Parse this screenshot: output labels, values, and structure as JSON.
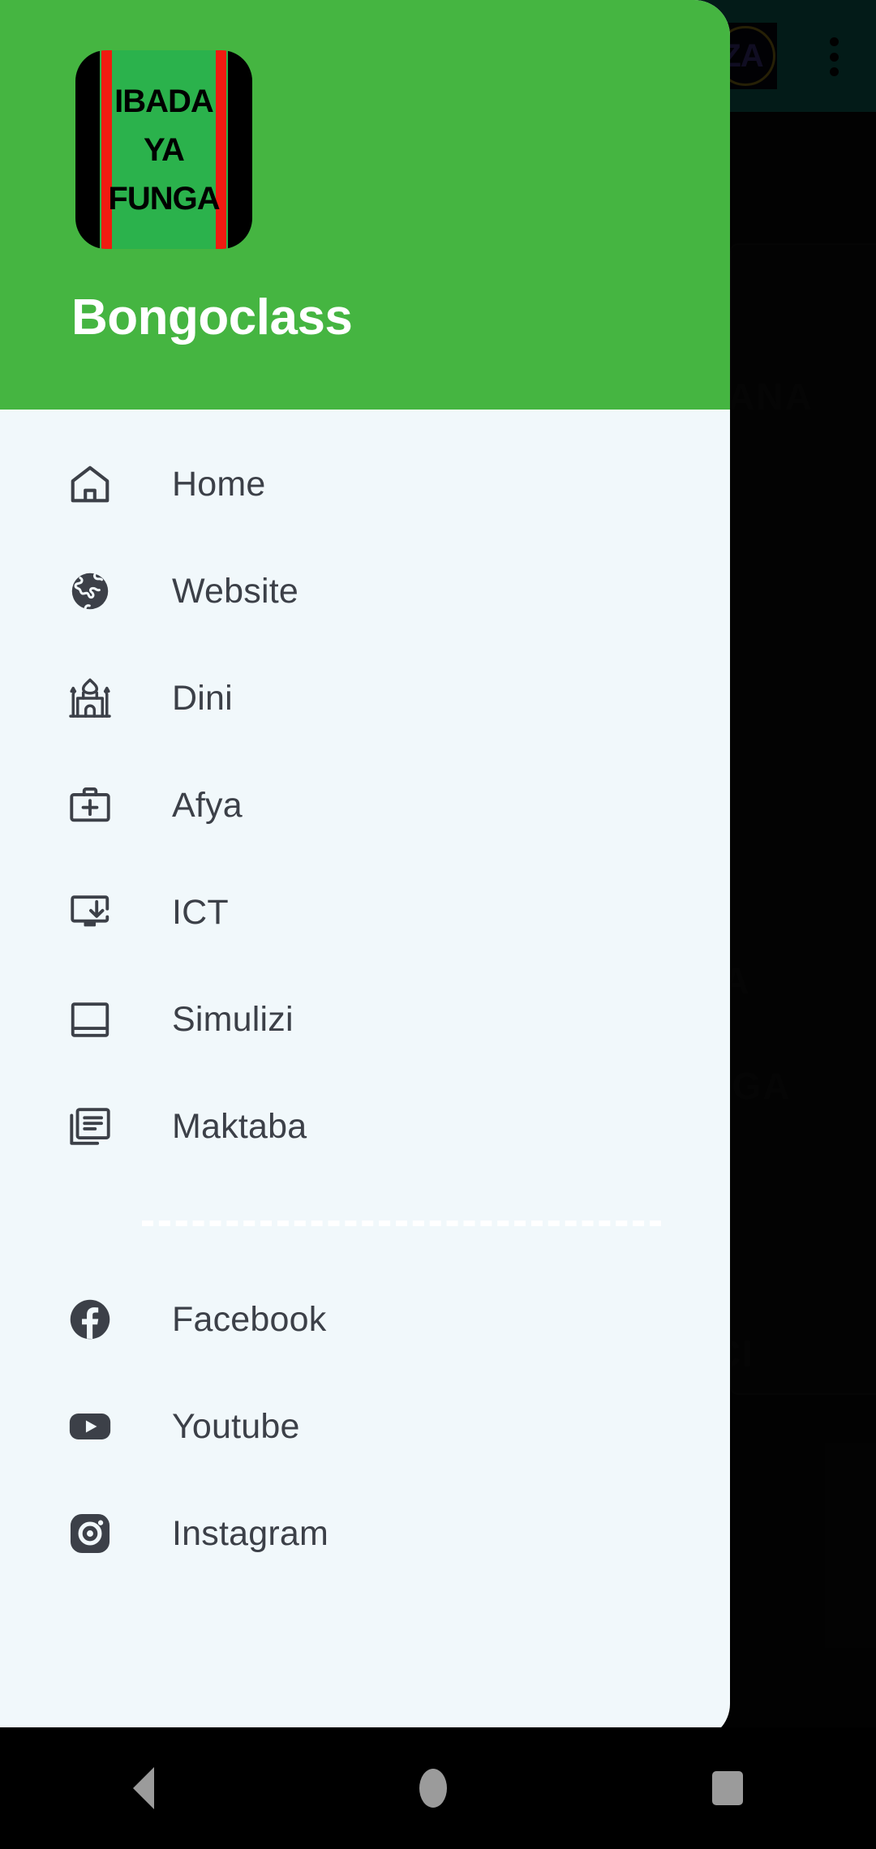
{
  "colors": {
    "drawer_header_green": "#45B541",
    "drawer_body": "#F1F8FB",
    "appbar_teal": "#0C6157",
    "menu_text": "#3C4048",
    "logo_green": "#2BB24C",
    "logo_red": "#F01B11",
    "nav_icon_gray": "#9B9B9B"
  },
  "background_app": {
    "appbar": {
      "logo_text": "ZA",
      "overflow_menu_name": "more-options"
    },
    "faint_texts": [
      "IMANA",
      "UNGA",
      "ZI",
      "YA",
      "JCI"
    ]
  },
  "drawer": {
    "logo": {
      "line1": "IBADA",
      "line2": "YA",
      "line3": "FUNGA"
    },
    "title": "Bongoclass",
    "menu_items": [
      {
        "label": "Home",
        "icon": "home-icon"
      },
      {
        "label": "Website",
        "icon": "globe-icon"
      },
      {
        "label": "Dini",
        "icon": "mosque-icon"
      },
      {
        "label": "Afya",
        "icon": "medical-kit-icon"
      },
      {
        "label": "ICT",
        "icon": "monitor-download-icon"
      },
      {
        "label": "Simulizi",
        "icon": "book-icon"
      },
      {
        "label": "Maktaba",
        "icon": "library-icon"
      }
    ],
    "social_items": [
      {
        "label": "Facebook",
        "icon": "facebook-icon"
      },
      {
        "label": "Youtube",
        "icon": "youtube-icon"
      },
      {
        "label": "Instagram",
        "icon": "instagram-icon"
      }
    ]
  },
  "system_nav": {
    "back": "back-button",
    "home": "home-button",
    "recents": "recents-button"
  }
}
